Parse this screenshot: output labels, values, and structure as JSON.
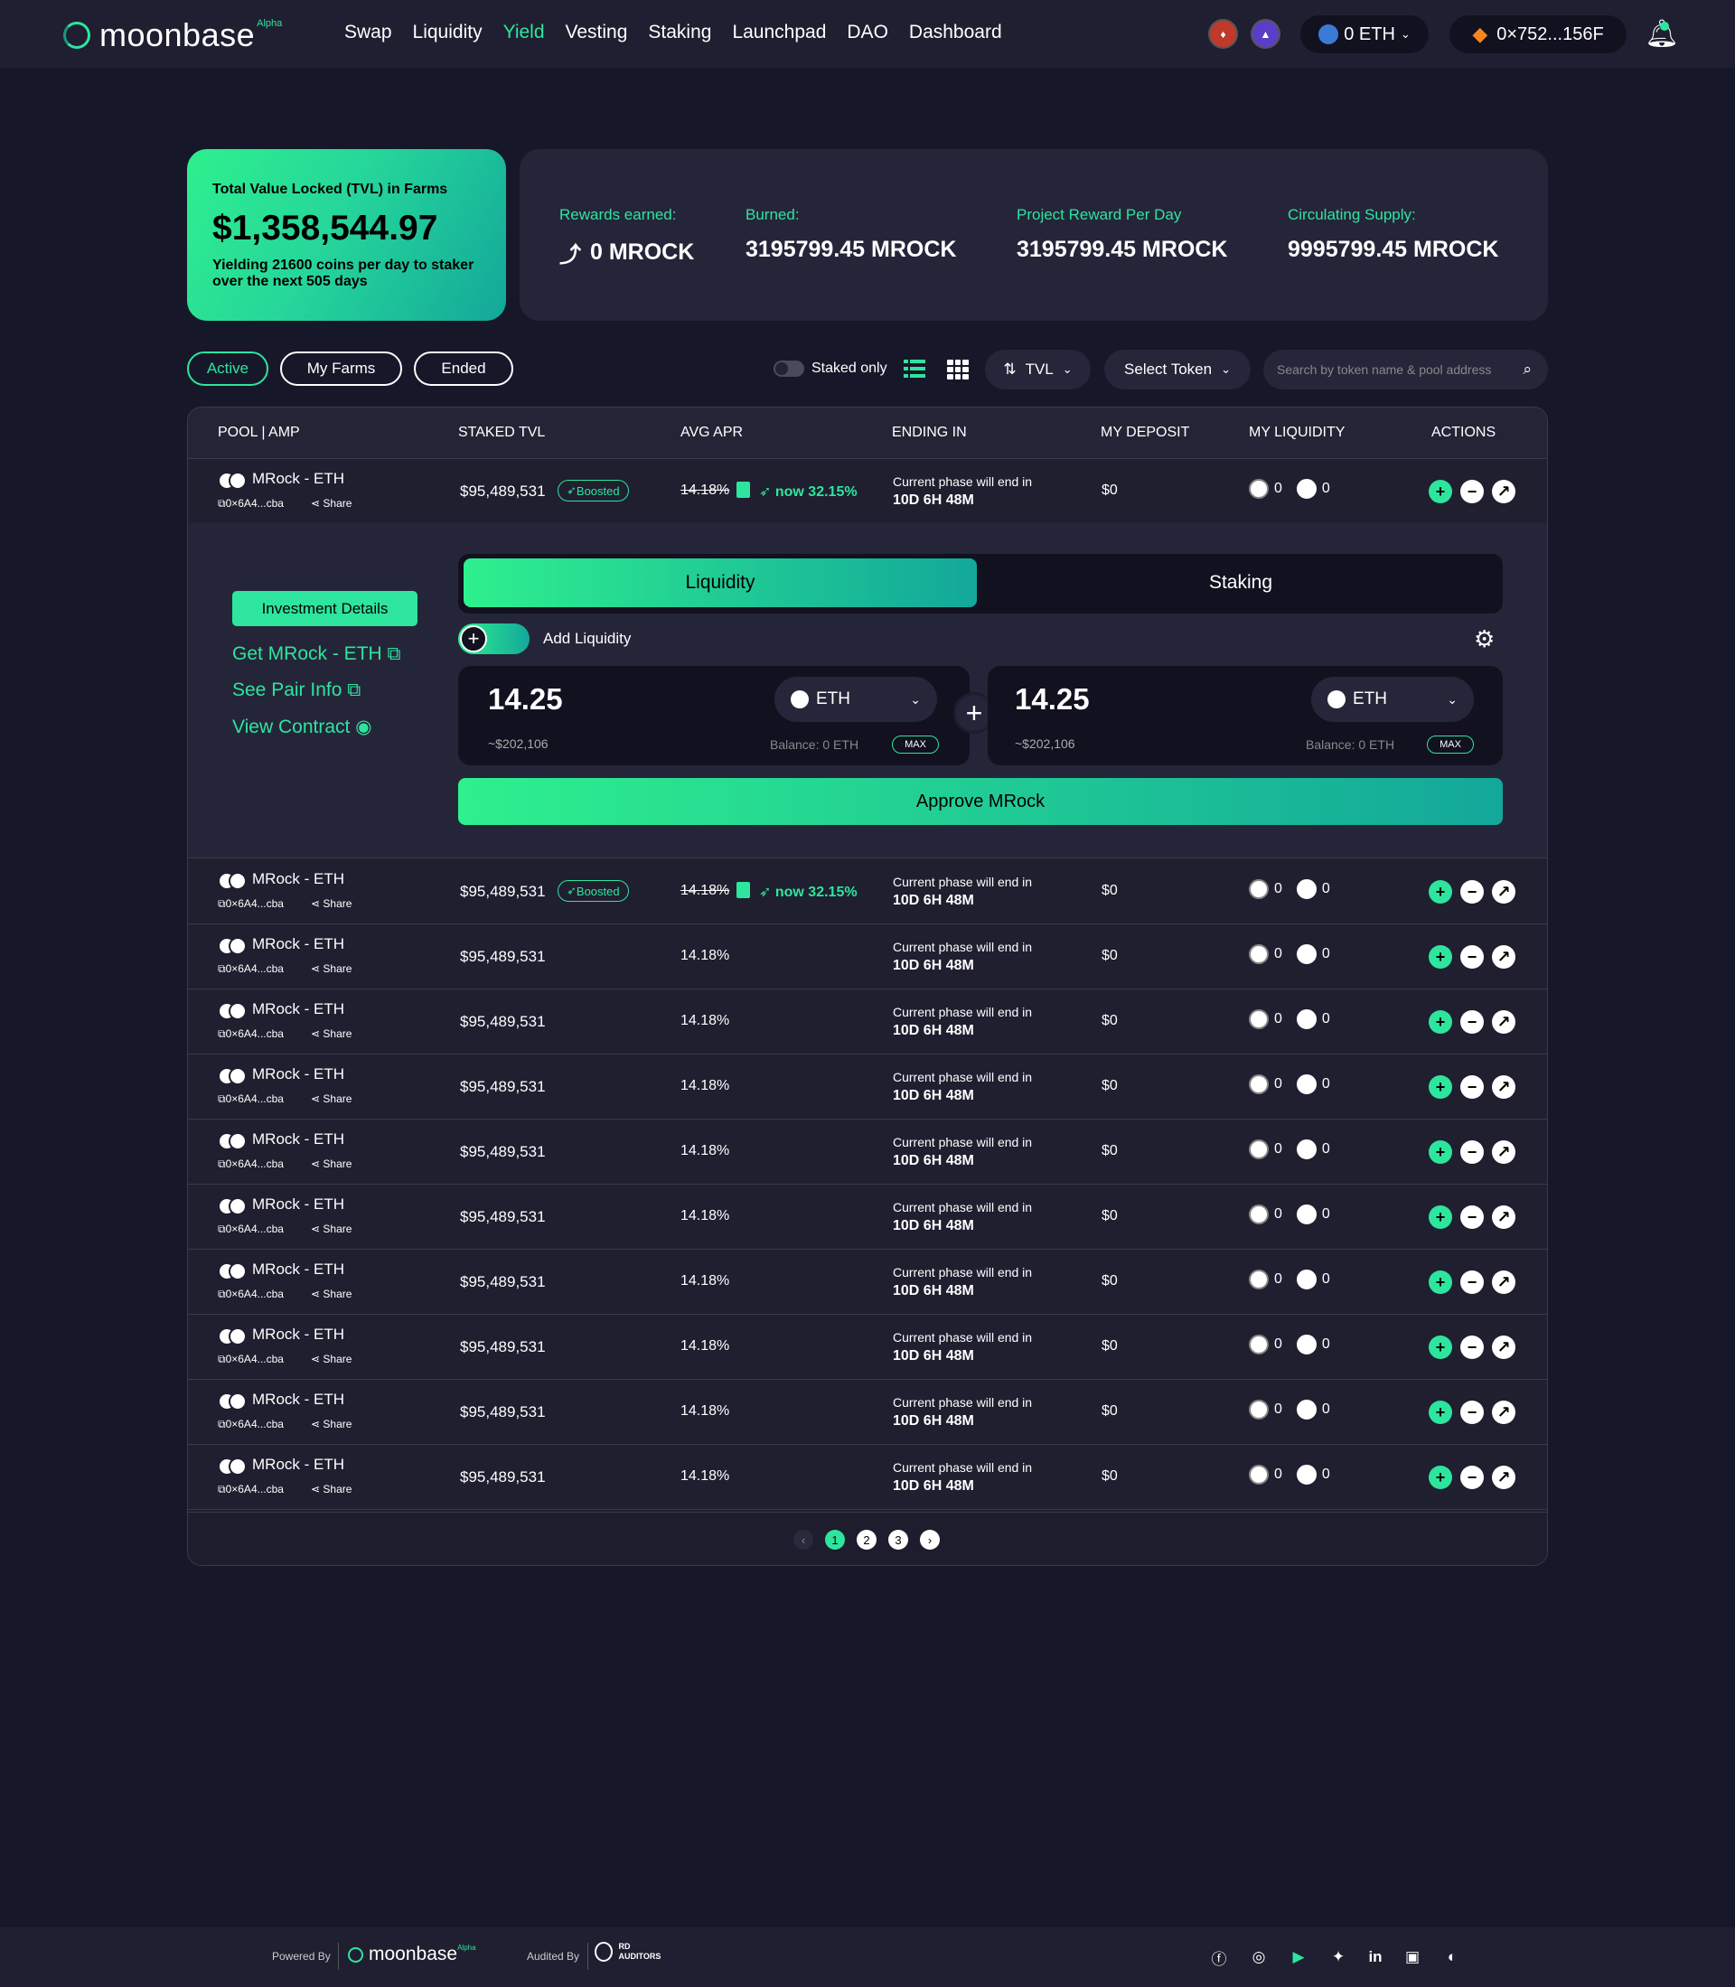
{
  "nav": {
    "logo": "moonbase",
    "logo_badge": "Alpha",
    "links": [
      "Swap",
      "Liquidity",
      "Yield",
      "Vesting",
      "Staking",
      "Launchpad",
      "DAO",
      "Dashboard"
    ],
    "active_link": "Yield",
    "balance": "0 ETH",
    "wallet": "0×752...156F"
  },
  "tvl": {
    "label": "Total Value Locked (TVL) in Farms",
    "value": "$1,358,544.97",
    "sub": "Yielding 21600 coins per day to staker over the next 505 days"
  },
  "stats": [
    {
      "label": "Rewards earned:",
      "value": "0 MROCK"
    },
    {
      "label": "Burned:",
      "value": "3195799.45 MROCK"
    },
    {
      "label": "Project Reward Per Day",
      "value": "3195799.45 MROCK"
    },
    {
      "label": "Circulating Supply:",
      "value": "9995799.45 MROCK"
    }
  ],
  "filters": {
    "active": "Active",
    "my_farms": "My Farms",
    "ended": "Ended"
  },
  "staked_only": "Staked only",
  "sort": "TVL",
  "select_token": "Select Token",
  "search_placeholder": "Search by token name & pool address",
  "columns": [
    "POOL | AMP",
    "STAKED TVL",
    "AVG APR",
    "ENDING IN",
    "MY DEPOSIT",
    "MY LIQUIDITY",
    "ACTIONS"
  ],
  "rows": [
    {
      "pool": "MRock - ETH",
      "addr": "0×6A4...cba",
      "share": "Share",
      "tvl": "$95,489,531",
      "boosted": "Boosted",
      "apr": "14.18%",
      "apr_now": "now 32.15%",
      "end_label": "Current phase will end in",
      "end": "10D 6H 48M",
      "deposit": "$0",
      "liq_a": "0",
      "liq_b": "0"
    },
    {
      "pool": "MRock - ETH",
      "addr": "0×6A4...cba",
      "share": "Share",
      "tvl": "$95,489,531",
      "boosted": "Boosted",
      "apr": "14.18%",
      "apr_now": "now 32.15%",
      "end_label": "Current phase will end in",
      "end": "10D 6H 48M",
      "deposit": "$0",
      "liq_a": "0",
      "liq_b": "0"
    },
    {
      "pool": "MRock - ETH",
      "addr": "0×6A4...cba",
      "share": "Share",
      "tvl": "$95,489,531",
      "apr": "14.18%",
      "end_label": "Current phase will end in",
      "end": "10D 6H 48M",
      "deposit": "$0",
      "liq_a": "0",
      "liq_b": "0"
    },
    {
      "pool": "MRock - ETH",
      "addr": "0×6A4...cba",
      "share": "Share",
      "tvl": "$95,489,531",
      "apr": "14.18%",
      "end_label": "Current phase will end in",
      "end": "10D 6H 48M",
      "deposit": "$0",
      "liq_a": "0",
      "liq_b": "0"
    },
    {
      "pool": "MRock - ETH",
      "addr": "0×6A4...cba",
      "share": "Share",
      "tvl": "$95,489,531",
      "apr": "14.18%",
      "end_label": "Current phase will end in",
      "end": "10D 6H 48M",
      "deposit": "$0",
      "liq_a": "0",
      "liq_b": "0"
    },
    {
      "pool": "MRock - ETH",
      "addr": "0×6A4...cba",
      "share": "Share",
      "tvl": "$95,489,531",
      "apr": "14.18%",
      "end_label": "Current phase will end in",
      "end": "10D 6H 48M",
      "deposit": "$0",
      "liq_a": "0",
      "liq_b": "0"
    },
    {
      "pool": "MRock - ETH",
      "addr": "0×6A4...cba",
      "share": "Share",
      "tvl": "$95,489,531",
      "apr": "14.18%",
      "end_label": "Current phase will end in",
      "end": "10D 6H 48M",
      "deposit": "$0",
      "liq_a": "0",
      "liq_b": "0"
    },
    {
      "pool": "MRock - ETH",
      "addr": "0×6A4...cba",
      "share": "Share",
      "tvl": "$95,489,531",
      "apr": "14.18%",
      "end_label": "Current phase will end in",
      "end": "10D 6H 48M",
      "deposit": "$0",
      "liq_a": "0",
      "liq_b": "0"
    },
    {
      "pool": "MRock - ETH",
      "addr": "0×6A4...cba",
      "share": "Share",
      "tvl": "$95,489,531",
      "apr": "14.18%",
      "end_label": "Current phase will end in",
      "end": "10D 6H 48M",
      "deposit": "$0",
      "liq_a": "0",
      "liq_b": "0"
    },
    {
      "pool": "MRock - ETH",
      "addr": "0×6A4...cba",
      "share": "Share",
      "tvl": "$95,489,531",
      "apr": "14.18%",
      "end_label": "Current phase will end in",
      "end": "10D 6H 48M",
      "deposit": "$0",
      "liq_a": "0",
      "liq_b": "0"
    },
    {
      "pool": "MRock - ETH",
      "addr": "0×6A4...cba",
      "share": "Share",
      "tvl": "$95,489,531",
      "apr": "14.18%",
      "end_label": "Current phase will end in",
      "end": "10D 6H 48M",
      "deposit": "$0",
      "liq_a": "0",
      "liq_b": "0"
    }
  ],
  "expanded": {
    "investment_details": "Investment Details",
    "get_token": "Get MRock - ETH",
    "pair_info": "See Pair Info",
    "view_contract": "View Contract",
    "tab_liquidity": "Liquidity",
    "tab_staking": "Staking",
    "add_liquidity": "Add Liquidity",
    "input_a": {
      "value": "14.25",
      "usd": "~$202,106",
      "token": "ETH",
      "balance": "Balance: 0 ETH",
      "max": "MAX"
    },
    "input_b": {
      "value": "14.25",
      "usd": "~$202,106",
      "token": "ETH",
      "balance": "Balance: 0 ETH",
      "max": "MAX"
    },
    "approve": "Approve MRock"
  },
  "pagination": [
    "1",
    "2",
    "3"
  ],
  "footer": {
    "powered_by": "Powered By",
    "logo": "moonbase",
    "logo_badge": "Alpha",
    "audited_by": "Audited By",
    "auditor_a": "RD",
    "auditor_b": "AUDITORS"
  },
  "colors": {
    "accent": "#2ee59d",
    "bg": "#17172a",
    "panel": "#25253a"
  }
}
